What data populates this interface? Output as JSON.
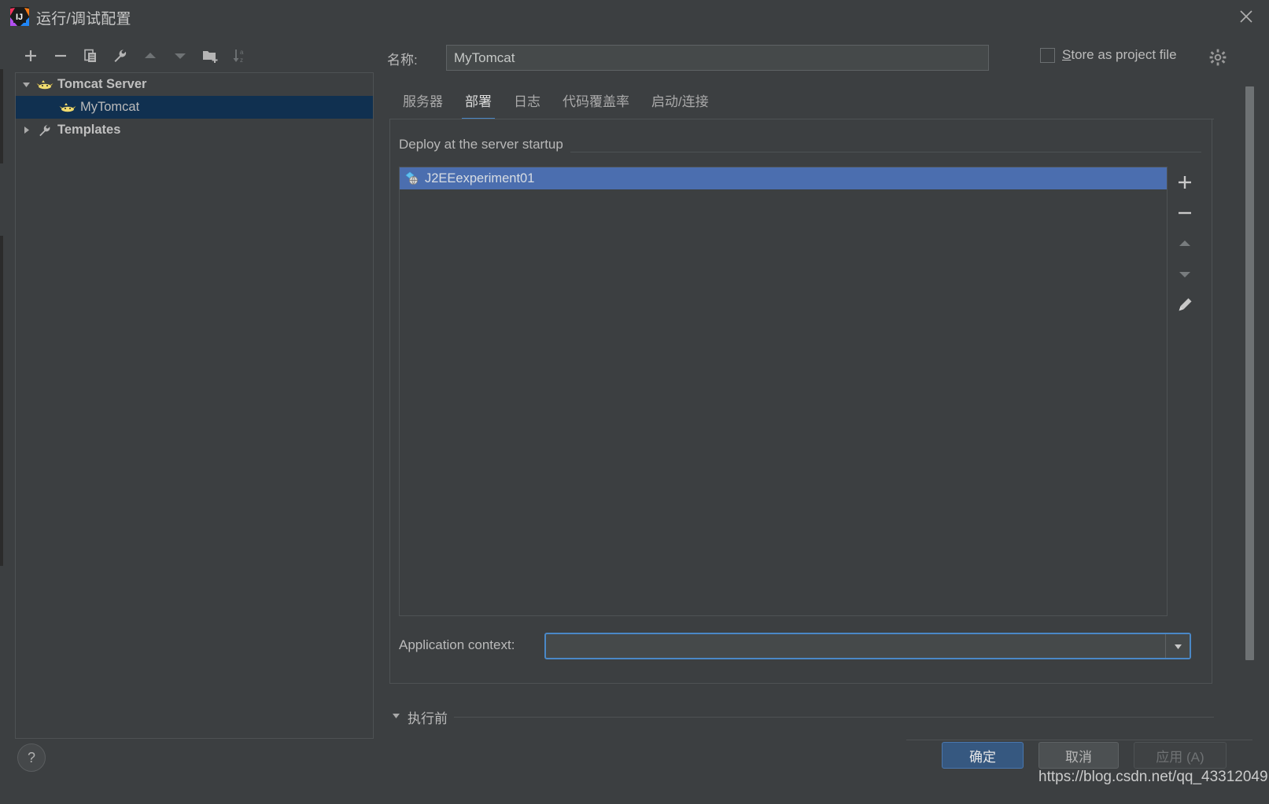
{
  "window": {
    "title": "运行/调试配置",
    "app_icon": "intellij-idea-icon",
    "close_label": "×"
  },
  "left_toolbar": {
    "buttons": [
      {
        "name": "add-configuration-button",
        "icon": "plus-icon",
        "label": "+"
      },
      {
        "name": "remove-configuration-button",
        "icon": "minus-icon",
        "label": "−"
      },
      {
        "name": "copy-configuration-button",
        "icon": "copy-icon",
        "label": "copy"
      },
      {
        "name": "edit-templates-button",
        "icon": "wrench-icon",
        "label": "wrench"
      },
      {
        "name": "move-up-button",
        "icon": "arrow-up-icon",
        "label": "▲"
      },
      {
        "name": "move-down-button",
        "icon": "arrow-down-icon",
        "label": "▼"
      },
      {
        "name": "new-folder-button",
        "icon": "folder-add-icon",
        "label": "folder"
      },
      {
        "name": "sort-alphabetically-button",
        "icon": "sort-az-icon",
        "label": "↓az"
      }
    ]
  },
  "tree": {
    "nodes": [
      {
        "label": "Tomcat Server",
        "icon": "tomcat-icon",
        "expanded": true,
        "bold": true,
        "selected": false,
        "indent": 0
      },
      {
        "label": "MyTomcat",
        "icon": "tomcat-icon",
        "expanded": null,
        "bold": false,
        "selected": true,
        "indent": 1
      },
      {
        "label": "Templates",
        "icon": "wrench-icon",
        "expanded": false,
        "bold": true,
        "selected": false,
        "indent": 0
      }
    ]
  },
  "help": {
    "label": "?"
  },
  "form": {
    "name_label": "名称:",
    "name_value": "MyTomcat",
    "store_as_project_file": {
      "checked": false,
      "label_prefix": "",
      "mnemonic": "S",
      "label_rest": "tore as project file"
    },
    "settings_gear": "gear-icon"
  },
  "tabs": [
    {
      "label": "服务器",
      "active": false
    },
    {
      "label": "部署",
      "active": true
    },
    {
      "label": "日志",
      "active": false
    },
    {
      "label": "代码覆盖率",
      "active": false
    },
    {
      "label": "启动/连接",
      "active": false
    }
  ],
  "deploy": {
    "group_title": "Deploy at the server startup",
    "items": [
      {
        "label": "J2EEexperiment01",
        "icon": "artifact-icon",
        "selected": true
      }
    ],
    "toolbar": [
      {
        "name": "add-artifact-button",
        "icon": "plus-icon",
        "label": "+"
      },
      {
        "name": "remove-artifact-button",
        "icon": "minus-icon",
        "label": "−"
      },
      {
        "name": "move-artifact-up-button",
        "icon": "arrow-up-icon",
        "label": "▲"
      },
      {
        "name": "move-artifact-down-button",
        "icon": "arrow-down-icon",
        "label": "▼"
      },
      {
        "name": "edit-artifact-button",
        "icon": "pencil-icon",
        "label": "✎"
      }
    ],
    "application_context_label": "Application context:",
    "application_context_value": "",
    "application_context_placeholder": ""
  },
  "before_launch": {
    "label": "执行前",
    "expanded": true
  },
  "buttons": {
    "ok": "确定",
    "cancel": "取消",
    "apply": "应用 (A)"
  },
  "watermark": "https://blog.csdn.net/qq_43312049",
  "colors": {
    "background": "#3c3f41",
    "selection_tree": "#103050",
    "selection_list": "#4b6eaf",
    "accent": "#4a88c7",
    "ok_button": "#365880",
    "border": "#4e5254"
  }
}
